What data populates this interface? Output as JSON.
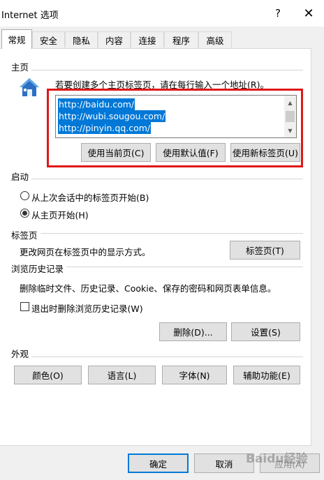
{
  "window": {
    "title": "Internet 选项",
    "help_glyph": "?",
    "close_glyph": "✕"
  },
  "tabs": [
    {
      "label": "常规",
      "active": true
    },
    {
      "label": "安全"
    },
    {
      "label": "隐私"
    },
    {
      "label": "内容"
    },
    {
      "label": "连接"
    },
    {
      "label": "程序"
    },
    {
      "label": "高级"
    }
  ],
  "home": {
    "group_label": "主页",
    "instruction": "若要创建多个主页标签页，请在每行输入一个地址(R)。",
    "urls": [
      "http://baidu.com/",
      "http://wubi.sougou.com/",
      "http://pinyin.qq.com/"
    ],
    "btn_current": "使用当前页(C)",
    "btn_default": "使用默认值(F)",
    "btn_newtab": "使用新标签页(U)"
  },
  "startup": {
    "group_label": "启动",
    "option_last": "从上次会话中的标签页开始(B)",
    "option_home": "从主页开始(H)",
    "selected": "home"
  },
  "tabs_group": {
    "group_label": "标签页",
    "description": "更改网页在标签页中的显示方式。",
    "btn_tabs": "标签页(T)"
  },
  "history": {
    "group_label": "浏览历史记录",
    "description": "删除临时文件、历史记录、Cookie、保存的密码和网页表单信息。",
    "checkbox_label": "退出时删除浏览历史记录(W)",
    "checked": false,
    "btn_delete": "删除(D)...",
    "btn_settings": "设置(S)"
  },
  "appearance": {
    "group_label": "外观",
    "btn_colors": "颜色(O)",
    "btn_languages": "语言(L)",
    "btn_fonts": "字体(N)",
    "btn_accessibility": "辅助功能(E)"
  },
  "footer": {
    "btn_ok": "确定",
    "btn_cancel": "取消",
    "btn_apply": "应用(A)"
  },
  "watermark_text": "Baidu经验",
  "colors": {
    "accent": "#0078d7",
    "highlight_box": "#e01717"
  }
}
